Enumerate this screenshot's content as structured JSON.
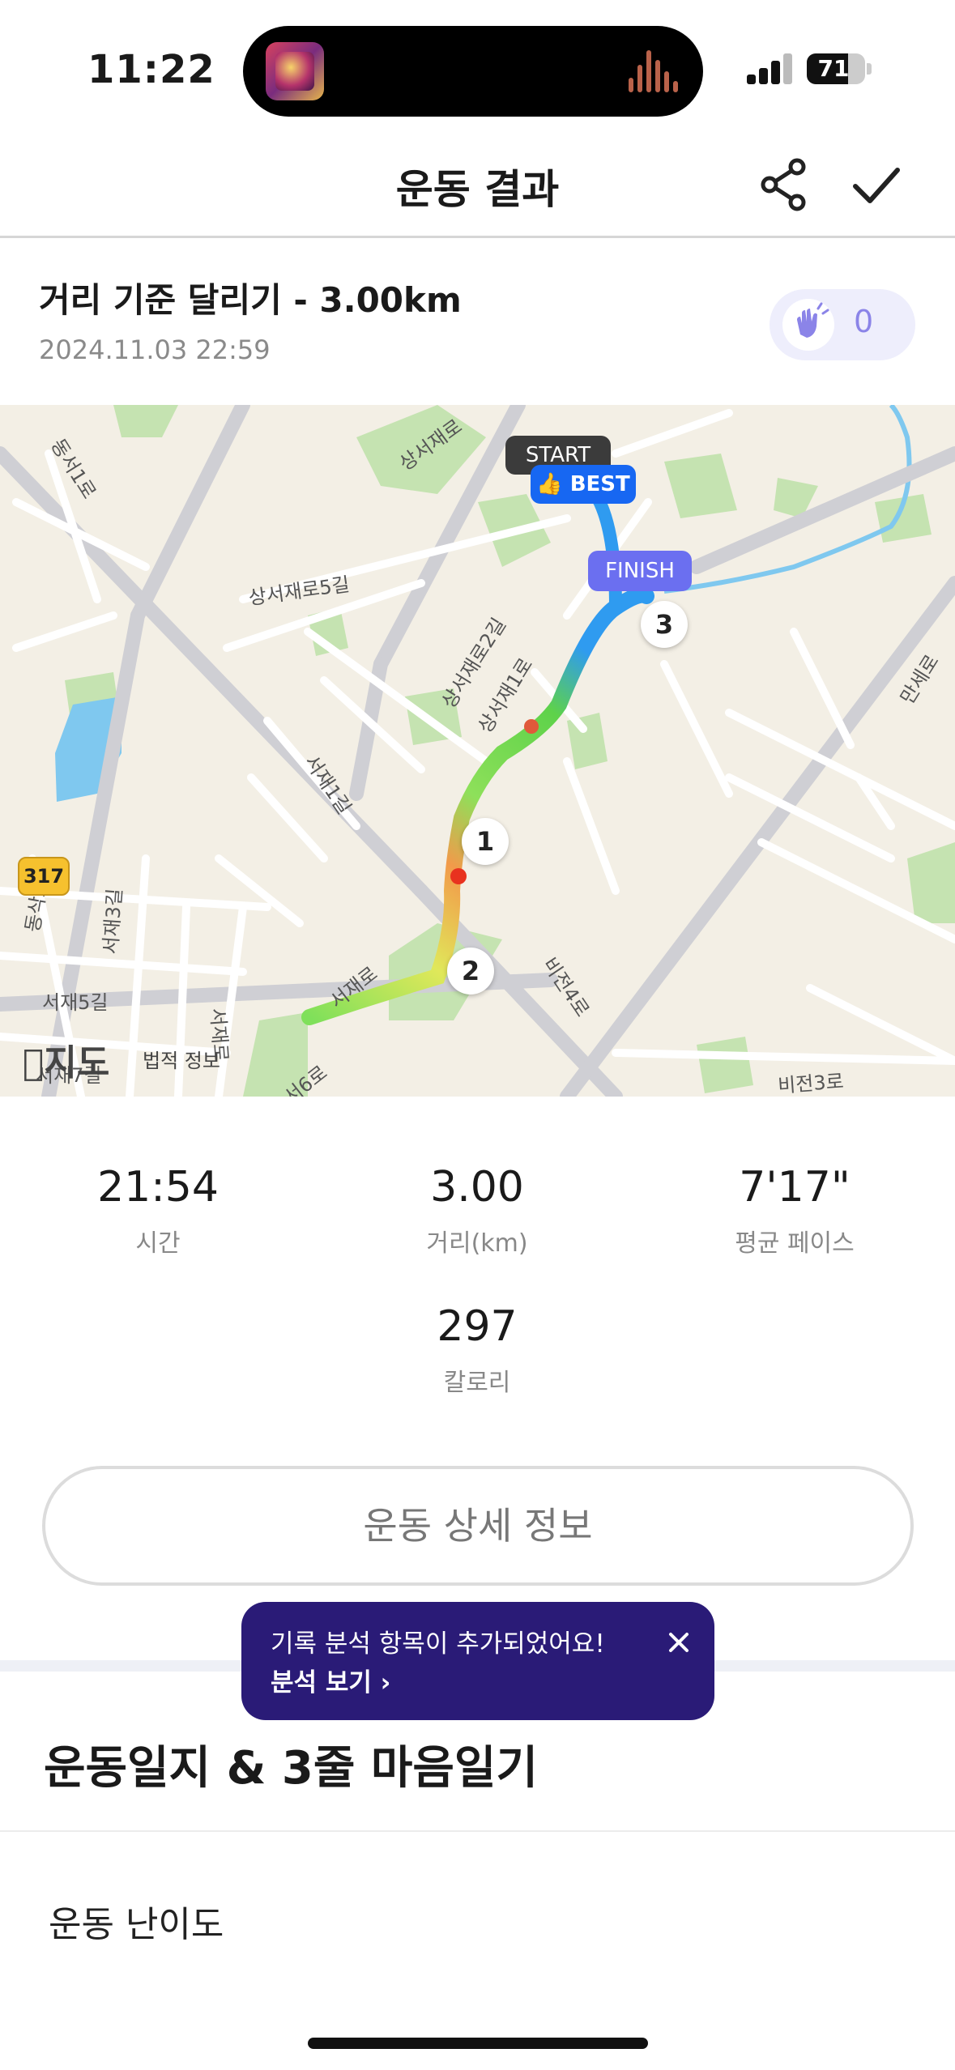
{
  "status_bar": {
    "time": "11:22",
    "battery": "71",
    "battery_level": 0.71
  },
  "header": {
    "title": "운동 결과",
    "share_icon": "share-icon",
    "confirm_icon": "checkmark-icon"
  },
  "run": {
    "title": "거리 기준 달리기 - 3.00km",
    "date": "2024.11.03 22:59",
    "clap_icon": "clap-icon",
    "clap_count": "0"
  },
  "map": {
    "labels": {
      "road1": "동서1로",
      "road2": "상서재로",
      "road3": "상서재로5길",
      "road4": "상서재로2길",
      "road5": "상서재1로",
      "road6": "서재1길",
      "road7": "서재로",
      "road8": "비전4로",
      "road9": "만세로",
      "road10": "서재5길",
      "road11": "동삭로",
      "road12": "서재3길",
      "road13": "비전3로",
      "road14": "서재7길",
      "road15": "서재로",
      "road16": "서6로"
    },
    "highway": "317",
    "pins": {
      "start": "START",
      "best": "BEST",
      "finish": "FINISH"
    },
    "km_markers": [
      "1",
      "2",
      "3"
    ],
    "logo": "지도",
    "legal": "법적 정보"
  },
  "stats": {
    "time": {
      "value": "21:54",
      "label": "시간"
    },
    "distance": {
      "value": "3.00",
      "label": "거리(km)"
    },
    "pace": {
      "value": "7'17\"",
      "label": "평균 페이스"
    },
    "calories": {
      "value": "297",
      "label": "칼로리"
    }
  },
  "detail_button": "운동 상세 정보",
  "tooltip": {
    "text": "기록 분석 항목이 추가되었어요!",
    "link": "분석 보기",
    "close_icon": "close-icon"
  },
  "diary": {
    "title": "운동일지 & 3줄 마음일기",
    "difficulty_label": "운동 난이도"
  },
  "colors": {
    "accent": "#2a1b77",
    "best": "#1767f2",
    "finish": "#6b6ff0",
    "clap": "#8b84e8"
  }
}
